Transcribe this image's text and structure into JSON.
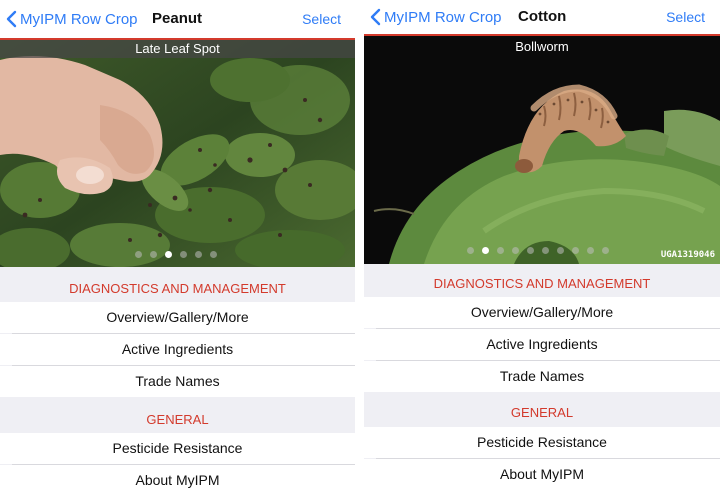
{
  "left": {
    "nav": {
      "back_label": "MyIPM Row Crop",
      "title": "Peanut",
      "select_label": "Select"
    },
    "photo": {
      "caption": "Late Leaf Spot",
      "dot_count": 6,
      "active_dot": 2
    },
    "sections": [
      {
        "header": "DIAGNOSTICS AND MANAGEMENT",
        "items": [
          "Overview/Gallery/More",
          "Active Ingredients",
          "Trade Names"
        ]
      },
      {
        "header": "GENERAL",
        "items": [
          "Pesticide Resistance",
          "About MyIPM"
        ]
      }
    ]
  },
  "right": {
    "nav": {
      "back_label": "MyIPM Row Crop",
      "title": "Cotton",
      "select_label": "Select"
    },
    "photo": {
      "caption": "Bollworm",
      "credit": "UGA1319046",
      "dot_count": 10,
      "active_dot": 1
    },
    "sections": [
      {
        "header": "DIAGNOSTICS AND MANAGEMENT",
        "items": [
          "Overview/Gallery/More",
          "Active Ingredients",
          "Trade Names"
        ]
      },
      {
        "header": "GENERAL",
        "items": [
          "Pesticide Resistance",
          "About MyIPM"
        ]
      }
    ]
  },
  "colors": {
    "accent_blue": "#2f7cf6",
    "accent_red": "#d33a2c",
    "group_bg": "#efeff4"
  },
  "icons": {
    "back": "chevron-left-icon"
  }
}
